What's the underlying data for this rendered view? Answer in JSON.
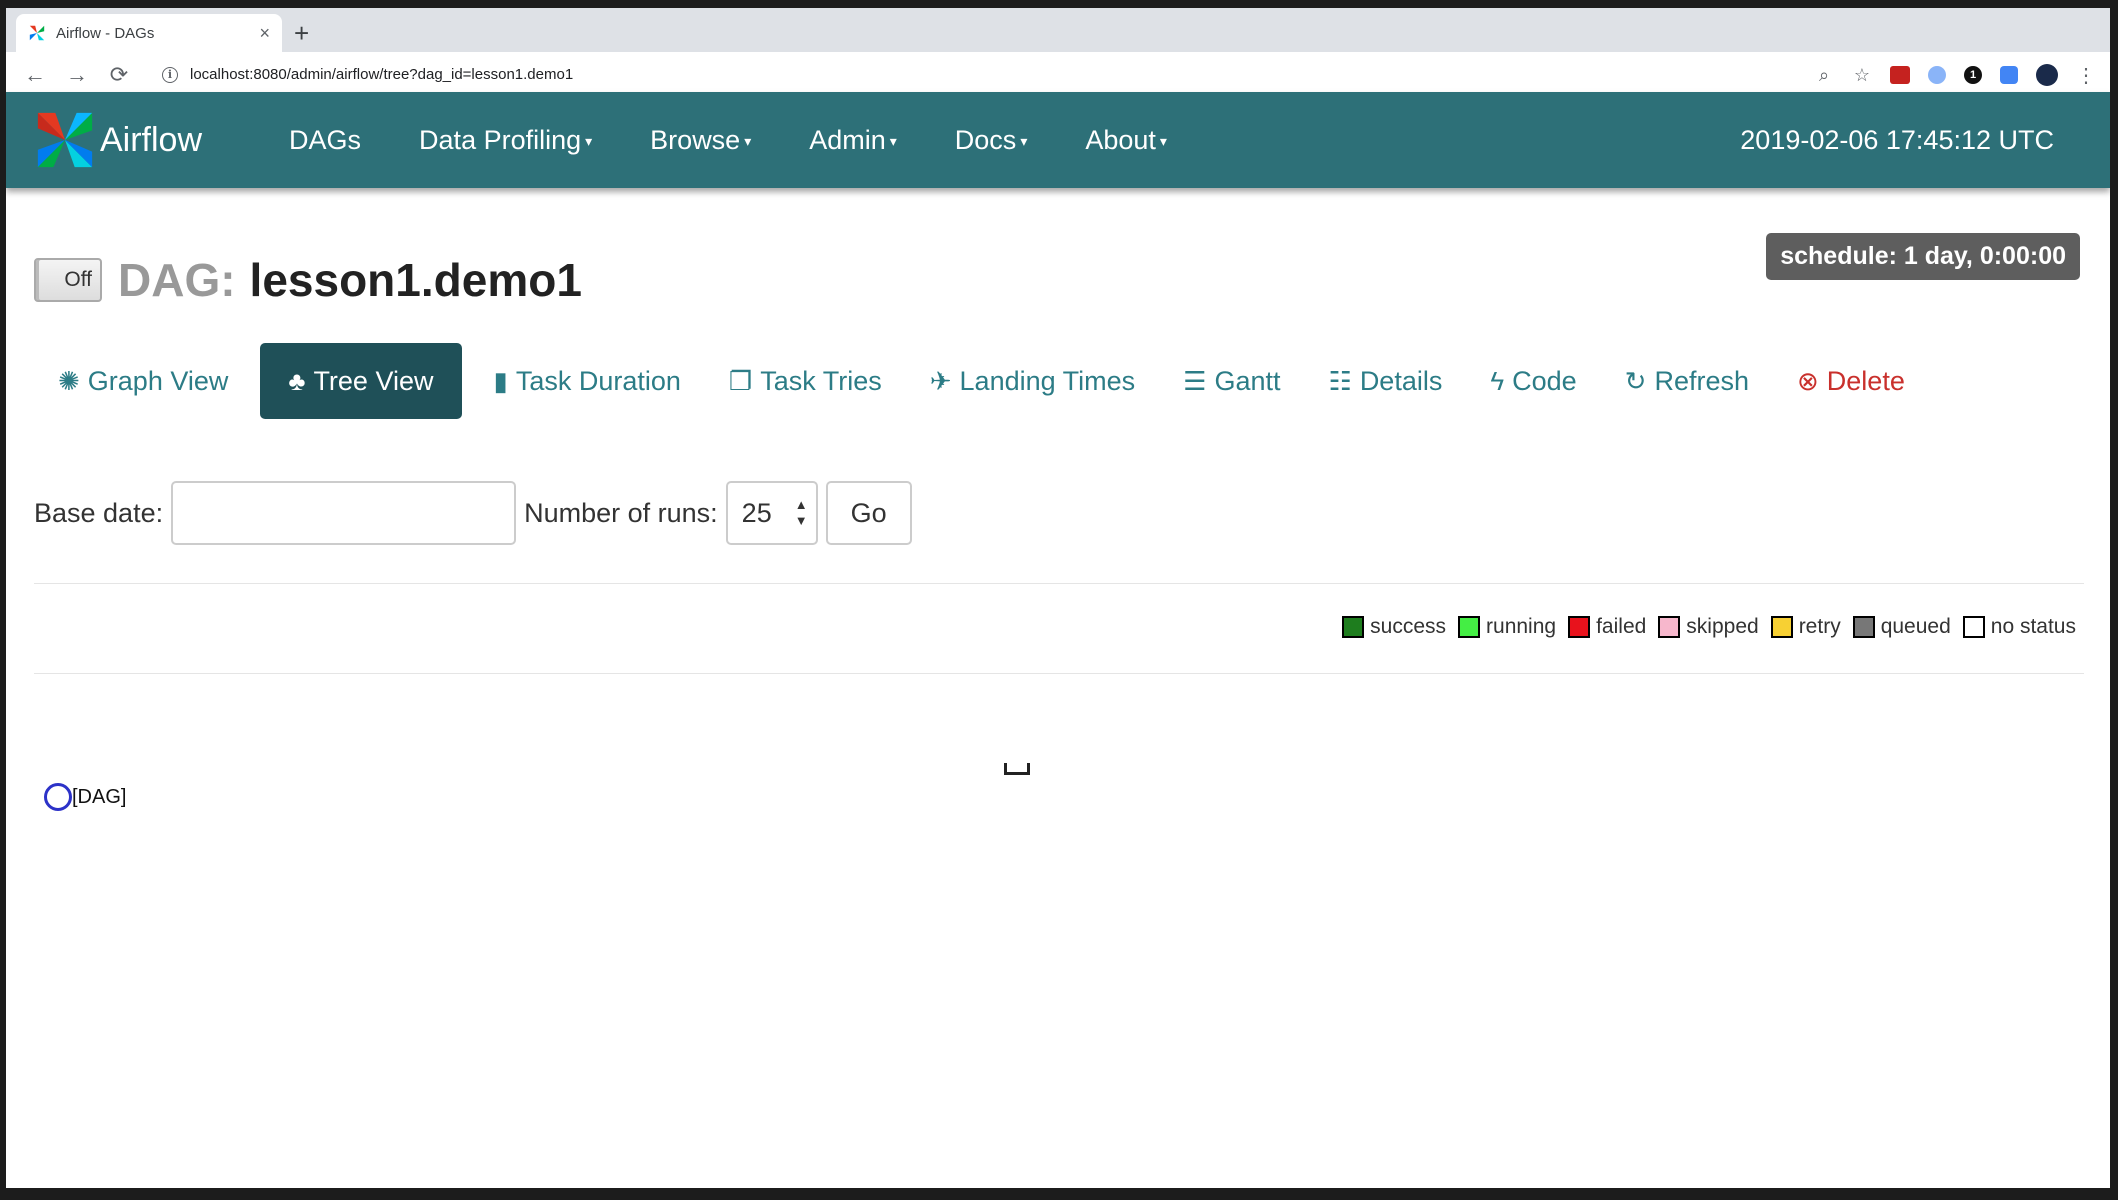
{
  "browser": {
    "tab_title": "Airflow - DAGs",
    "tab_close": "×",
    "new_tab": "+",
    "back": "←",
    "forward": "→",
    "reload": "⟳",
    "info": "i",
    "url": "localhost:8080/admin/airflow/tree?dag_id=lesson1.demo1",
    "zoom_icon": "⌕",
    "star_icon": "☆",
    "ext_badge": "1",
    "menu_icon": "⋮"
  },
  "navbar": {
    "brand": "Airflow",
    "menu": [
      {
        "label": "DAGs",
        "caret": ""
      },
      {
        "label": "Data Profiling",
        "caret": "▾"
      },
      {
        "label": "Browse",
        "caret": "▾"
      },
      {
        "label": "Admin",
        "caret": "▾"
      },
      {
        "label": "Docs",
        "caret": "▾"
      },
      {
        "label": "About",
        "caret": "▾"
      }
    ],
    "clock": "2019-02-06 17:45:12 UTC",
    "color": "#2d7078"
  },
  "dag": {
    "toggle": "Off",
    "label": "DAG:",
    "id": "lesson1.demo1",
    "schedule": "schedule: 1 day, 0:00:00"
  },
  "views": [
    {
      "label": "Graph View",
      "icon": "✺"
    },
    {
      "label": "Tree View",
      "icon": "♣"
    },
    {
      "label": "Task Duration",
      "icon": "▮"
    },
    {
      "label": "Task Tries",
      "icon": "❐"
    },
    {
      "label": "Landing Times",
      "icon": "✈"
    },
    {
      "label": "Gantt",
      "icon": "☰"
    },
    {
      "label": "Details",
      "icon": "☷"
    },
    {
      "label": "Code",
      "icon": "ϟ"
    },
    {
      "label": "Refresh",
      "icon": "↻"
    },
    {
      "label": "Delete",
      "icon": "⊗"
    }
  ],
  "form": {
    "base_date_label": "Base date:",
    "base_date_value": "",
    "runs_label": "Number of runs:",
    "runs_value": "25",
    "runs_arrows": "▲▼",
    "go": "Go"
  },
  "legend": [
    {
      "label": "success",
      "color": "#1e7d1e"
    },
    {
      "label": "running",
      "color": "#44ee44"
    },
    {
      "label": "failed",
      "color": "#e8121c"
    },
    {
      "label": "skipped",
      "color": "#f7b7cc"
    },
    {
      "label": "retry",
      "color": "#f7d033"
    },
    {
      "label": "queued",
      "color": "#777777"
    },
    {
      "label": "no status",
      "color": "#ffffff"
    }
  ],
  "tree": {
    "root_label": "[DAG]"
  }
}
